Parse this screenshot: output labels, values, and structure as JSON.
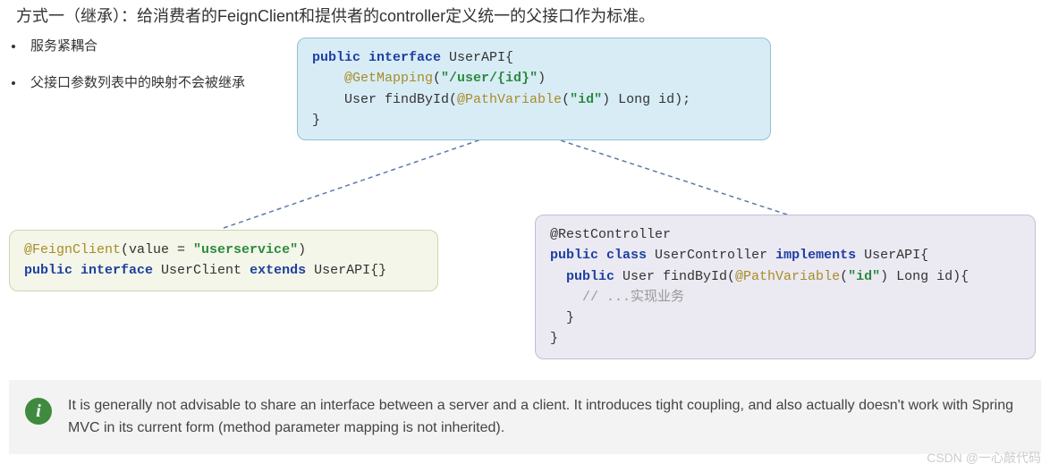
{
  "title": "方式一（继承）：给消费者的FeignClient和提供者的controller定义统一的父接口作为标准。",
  "bullets": [
    "服务紧耦合",
    "父接口参数列表中的映射不会被继承"
  ],
  "code_top": {
    "l1a": "public",
    "l1b": "interface",
    "l1c": " UserAPI{",
    "l2a": "    @GetMapping",
    "l2b": "(",
    "l2c": "\"/user/{id}\"",
    "l2d": ")",
    "l3a": "    User findById(",
    "l3b": "@PathVariable",
    "l3c": "(",
    "l3d": "\"id\"",
    "l3e": ") Long id);",
    "l4": "}"
  },
  "code_left": {
    "l1a": "@FeignClient",
    "l1b": "(value = ",
    "l1c": "\"userservice\"",
    "l1d": ")",
    "l2a": "public",
    "l2b": "interface",
    "l2c": " UserClient ",
    "l2d": "extends",
    "l2e": " UserAPI{}"
  },
  "code_right": {
    "l1": "@RestController",
    "l2a": "public",
    "l2b": "class",
    "l2c": " UserController ",
    "l2d": "implements",
    "l2e": " UserAPI{",
    "l3a": "  public",
    "l3b": " User findById(",
    "l3c": "@PathVariable",
    "l3d": "(",
    "l3e": "\"id\"",
    "l3f": ") Long id){",
    "l4": "    // ...实现业务",
    "l5": "  }",
    "l6": "}"
  },
  "info": {
    "icon": "i",
    "text": "It is generally not advisable to share an interface between a server and a client. It introduces tight coupling, and also actually doesn't work with Spring MVC in its current form (method parameter mapping is not inherited)."
  },
  "watermark": "CSDN @一心敲代码"
}
